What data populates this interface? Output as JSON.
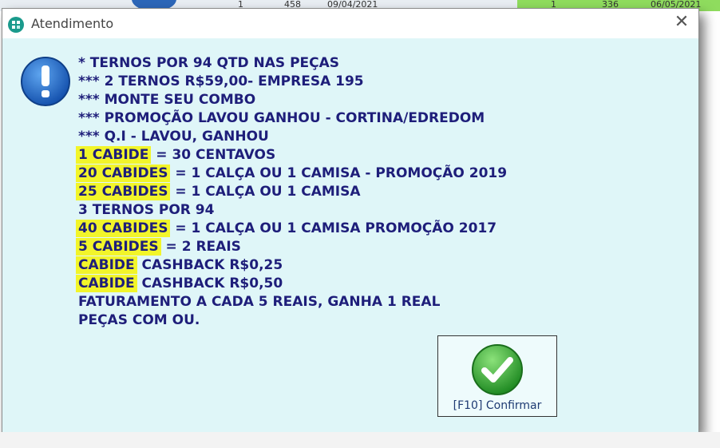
{
  "background": {
    "cells": [
      "1",
      "458",
      "09/04/2021",
      "1",
      "336",
      "06/05/2021"
    ]
  },
  "dialog": {
    "title": "Atendimento",
    "close_glyph": "✕",
    "lines": [
      {
        "highlight": "",
        "text": "* TERNOS POR 94 QTD NAS PEÇAS"
      },
      {
        "highlight": "",
        "text": "*** 2 TERNOS R$59,00- EMPRESA 195"
      },
      {
        "highlight": "",
        "text": "*** MONTE SEU COMBO"
      },
      {
        "highlight": "",
        "text": "*** PROMOÇÃO LAVOU GANHOU - CORTINA/EDREDOM"
      },
      {
        "highlight": "",
        "text": "*** Q.I - LAVOU, GANHOU"
      },
      {
        "highlight": "1 CABIDE",
        "text": " = 30 CENTAVOS"
      },
      {
        "highlight": "20 CABIDES",
        "text": " = 1 CALÇA OU 1 CAMISA - PROMOÇÃO 2019"
      },
      {
        "highlight": "25 CABIDES",
        "text": " = 1 CALÇA OU 1 CAMISA"
      },
      {
        "highlight": "",
        "text": "3 TERNOS POR 94"
      },
      {
        "highlight": "40 CABIDES",
        "text": " = 1 CALÇA OU 1 CAMISA PROMOÇÃO 2017"
      },
      {
        "highlight": "5 CABIDES",
        "text": " = 2 REAIS"
      },
      {
        "highlight": "CABIDE",
        "text": " CASHBACK R$0,25"
      },
      {
        "highlight": "CABIDE",
        "text": " CASHBACK R$0,50"
      },
      {
        "highlight": "",
        "text": "FATURAMENTO A CADA 5 REAIS, GANHA 1 REAL"
      },
      {
        "highlight": "",
        "text": "PEÇAS COM OU."
      }
    ],
    "confirm_label": "[F10] Confirmar"
  },
  "icons": {
    "title": "app-logo-icon",
    "info": "exclamation-icon",
    "confirm": "checkmark-icon",
    "close": "close-icon"
  },
  "colors": {
    "text": "#1e1e7a",
    "highlight": "#f2f52a",
    "content_bg": "#dff6f8",
    "check_green": "#2ea52e",
    "info_blue": "#1d66c4"
  }
}
